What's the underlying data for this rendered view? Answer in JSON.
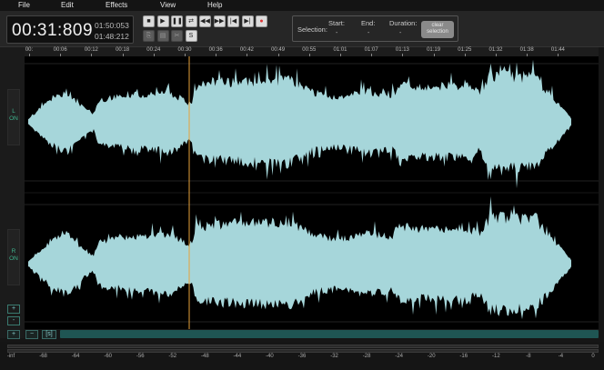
{
  "menu": [
    "File",
    "Edit",
    "Effects",
    "View",
    "Help"
  ],
  "timer": {
    "main": "00:31:809",
    "duration": "01:50:053",
    "position": "01:48:212"
  },
  "transport": {
    "row1": [
      {
        "name": "stop-icon",
        "glyph": "■"
      },
      {
        "name": "play-icon",
        "glyph": "▶"
      },
      {
        "name": "pause-icon",
        "glyph": "❚❚"
      },
      {
        "name": "loop-icon",
        "glyph": "⇄"
      },
      {
        "name": "rewind-icon",
        "glyph": "◀◀"
      },
      {
        "name": "fast-forward-icon",
        "glyph": "▶▶"
      },
      {
        "name": "skip-back-icon",
        "glyph": "|◀"
      },
      {
        "name": "skip-forward-icon",
        "glyph": "▶|"
      },
      {
        "name": "record-icon",
        "glyph": "●"
      }
    ],
    "row2": [
      {
        "name": "copy-icon",
        "glyph": "⎘"
      },
      {
        "name": "paste-icon",
        "glyph": "▤"
      },
      {
        "name": "cut-icon",
        "glyph": "✂"
      },
      {
        "name": "silence-icon",
        "glyph": "S"
      }
    ]
  },
  "selection": {
    "label": "Selection:",
    "start_label": "Start:",
    "end_label": "End:",
    "duration_label": "Duration:",
    "start": "-",
    "end": "-",
    "duration": "-",
    "clear_button": "clear selection"
  },
  "timeline": [
    "00:",
    "00:06",
    "00:12",
    "00:18",
    "00:24",
    "00:30",
    "00:36",
    "00:42",
    "00:49",
    "00:55",
    "01:01",
    "01:07",
    "01:13",
    "01:19",
    "01:25",
    "01:32",
    "01:38",
    "01:44"
  ],
  "channels": [
    {
      "letter": "L",
      "state": "ON"
    },
    {
      "letter": "R",
      "state": "ON"
    }
  ],
  "zoom_buttons": [
    "+",
    "-"
  ],
  "scroll_buttons": [
    "+",
    "−",
    "[s]"
  ],
  "playhead_time": "00:31:809",
  "meter_ticks": [
    "-inf",
    "-68",
    "-64",
    "-60",
    "-56",
    "-52",
    "-48",
    "-44",
    "-40",
    "-36",
    "-32",
    "-28",
    "-24",
    "-20",
    "-16",
    "-12",
    "-8",
    "-4",
    "0"
  ],
  "colors": {
    "waveform": "#a6d6da",
    "playhead": "#e8a23a",
    "background": "#000000",
    "accent": "#3fb58f",
    "scrollbar": "#1f5553"
  }
}
